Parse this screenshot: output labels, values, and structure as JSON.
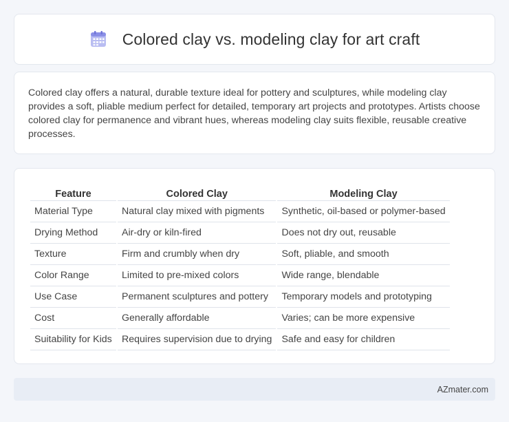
{
  "header": {
    "title": "Colored clay vs. modeling clay for art craft",
    "icon": "calendar-icon",
    "accent_color": "#8a8fe6"
  },
  "summary": {
    "text": "Colored clay offers a natural, durable texture ideal for pottery and sculptures, while modeling clay provides a soft, pliable medium perfect for detailed, temporary art projects and prototypes. Artists choose colored clay for permanence and vibrant hues, whereas modeling clay suits flexible, reusable creative processes."
  },
  "table": {
    "headers": [
      "Feature",
      "Colored Clay",
      "Modeling Clay"
    ],
    "rows": [
      [
        "Material Type",
        "Natural clay mixed with pigments",
        "Synthetic, oil-based or polymer-based"
      ],
      [
        "Drying Method",
        "Air-dry or kiln-fired",
        "Does not dry out, reusable"
      ],
      [
        "Texture",
        "Firm and crumbly when dry",
        "Soft, pliable, and smooth"
      ],
      [
        "Color Range",
        "Limited to pre-mixed colors",
        "Wide range, blendable"
      ],
      [
        "Use Case",
        "Permanent sculptures and pottery",
        "Temporary models and prototyping"
      ],
      [
        "Cost",
        "Generally affordable",
        "Varies; can be more expensive"
      ],
      [
        "Suitability for Kids",
        "Requires supervision due to drying",
        "Safe and easy for children"
      ]
    ]
  },
  "footer": {
    "brand": "AZmater.com"
  }
}
